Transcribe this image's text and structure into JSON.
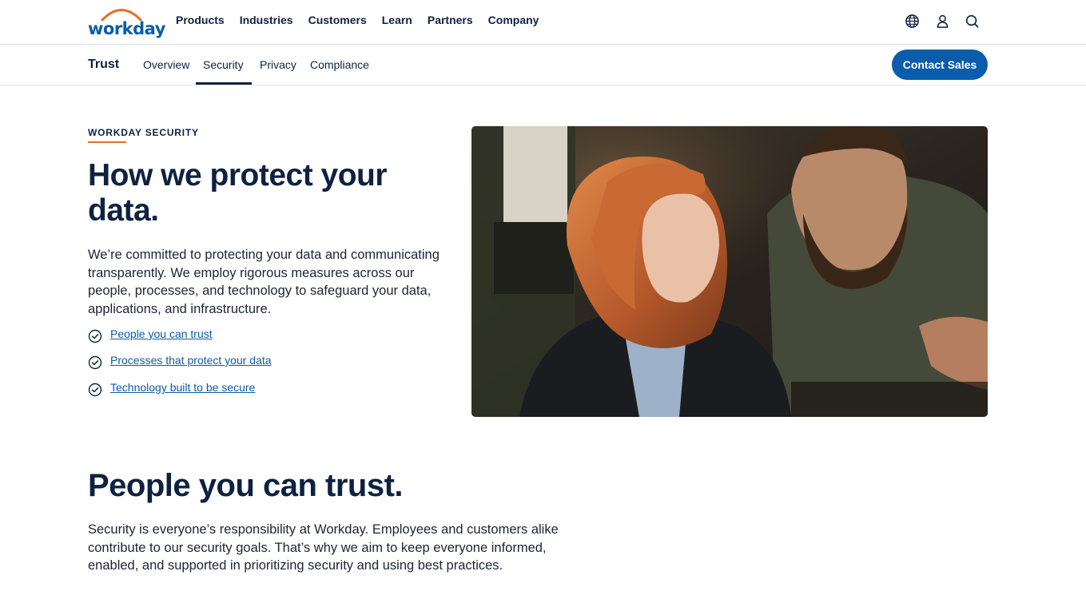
{
  "brand": {
    "logo_text": "workday",
    "primary_color": "#0b5cab",
    "accent_color": "#e56e22",
    "text_color": "#0e2240"
  },
  "topnav": {
    "menu": [
      {
        "label": "Products"
      },
      {
        "label": "Industries"
      },
      {
        "label": "Customers"
      },
      {
        "label": "Learn"
      },
      {
        "label": "Partners"
      },
      {
        "label": "Company"
      }
    ],
    "icons": [
      "globe-icon",
      "user-icon",
      "search-icon"
    ]
  },
  "subnav": {
    "title": "Trust",
    "tabs": [
      {
        "label": "Overview"
      },
      {
        "label": "Security",
        "active": true
      },
      {
        "label": "Privacy"
      },
      {
        "label": "Compliance"
      }
    ],
    "cta": "Contact Sales"
  },
  "hero": {
    "eyebrow": "WORKDAY SECURITY",
    "title": "How we protect your data.",
    "body": "We’re committed to protecting your data and communicating transparently. We employ rigorous measures across our people, processes, and technology to safeguard your data, applications, and infrastructure.",
    "links": [
      {
        "label": "People you can trust",
        "icon": "check-circle-icon"
      },
      {
        "label": "Processes that protect your data",
        "icon": "check-circle-icon"
      },
      {
        "label": "Technology built to be secure",
        "icon": "check-circle-icon"
      }
    ]
  },
  "section": {
    "title": "People you can trust.",
    "body": "Security is everyone’s responsibility at Workday. Employees and customers alike contribute to our security goals. That’s why we aim to keep everyone informed, enabled, and supported in prioritizing security and using best practices."
  }
}
